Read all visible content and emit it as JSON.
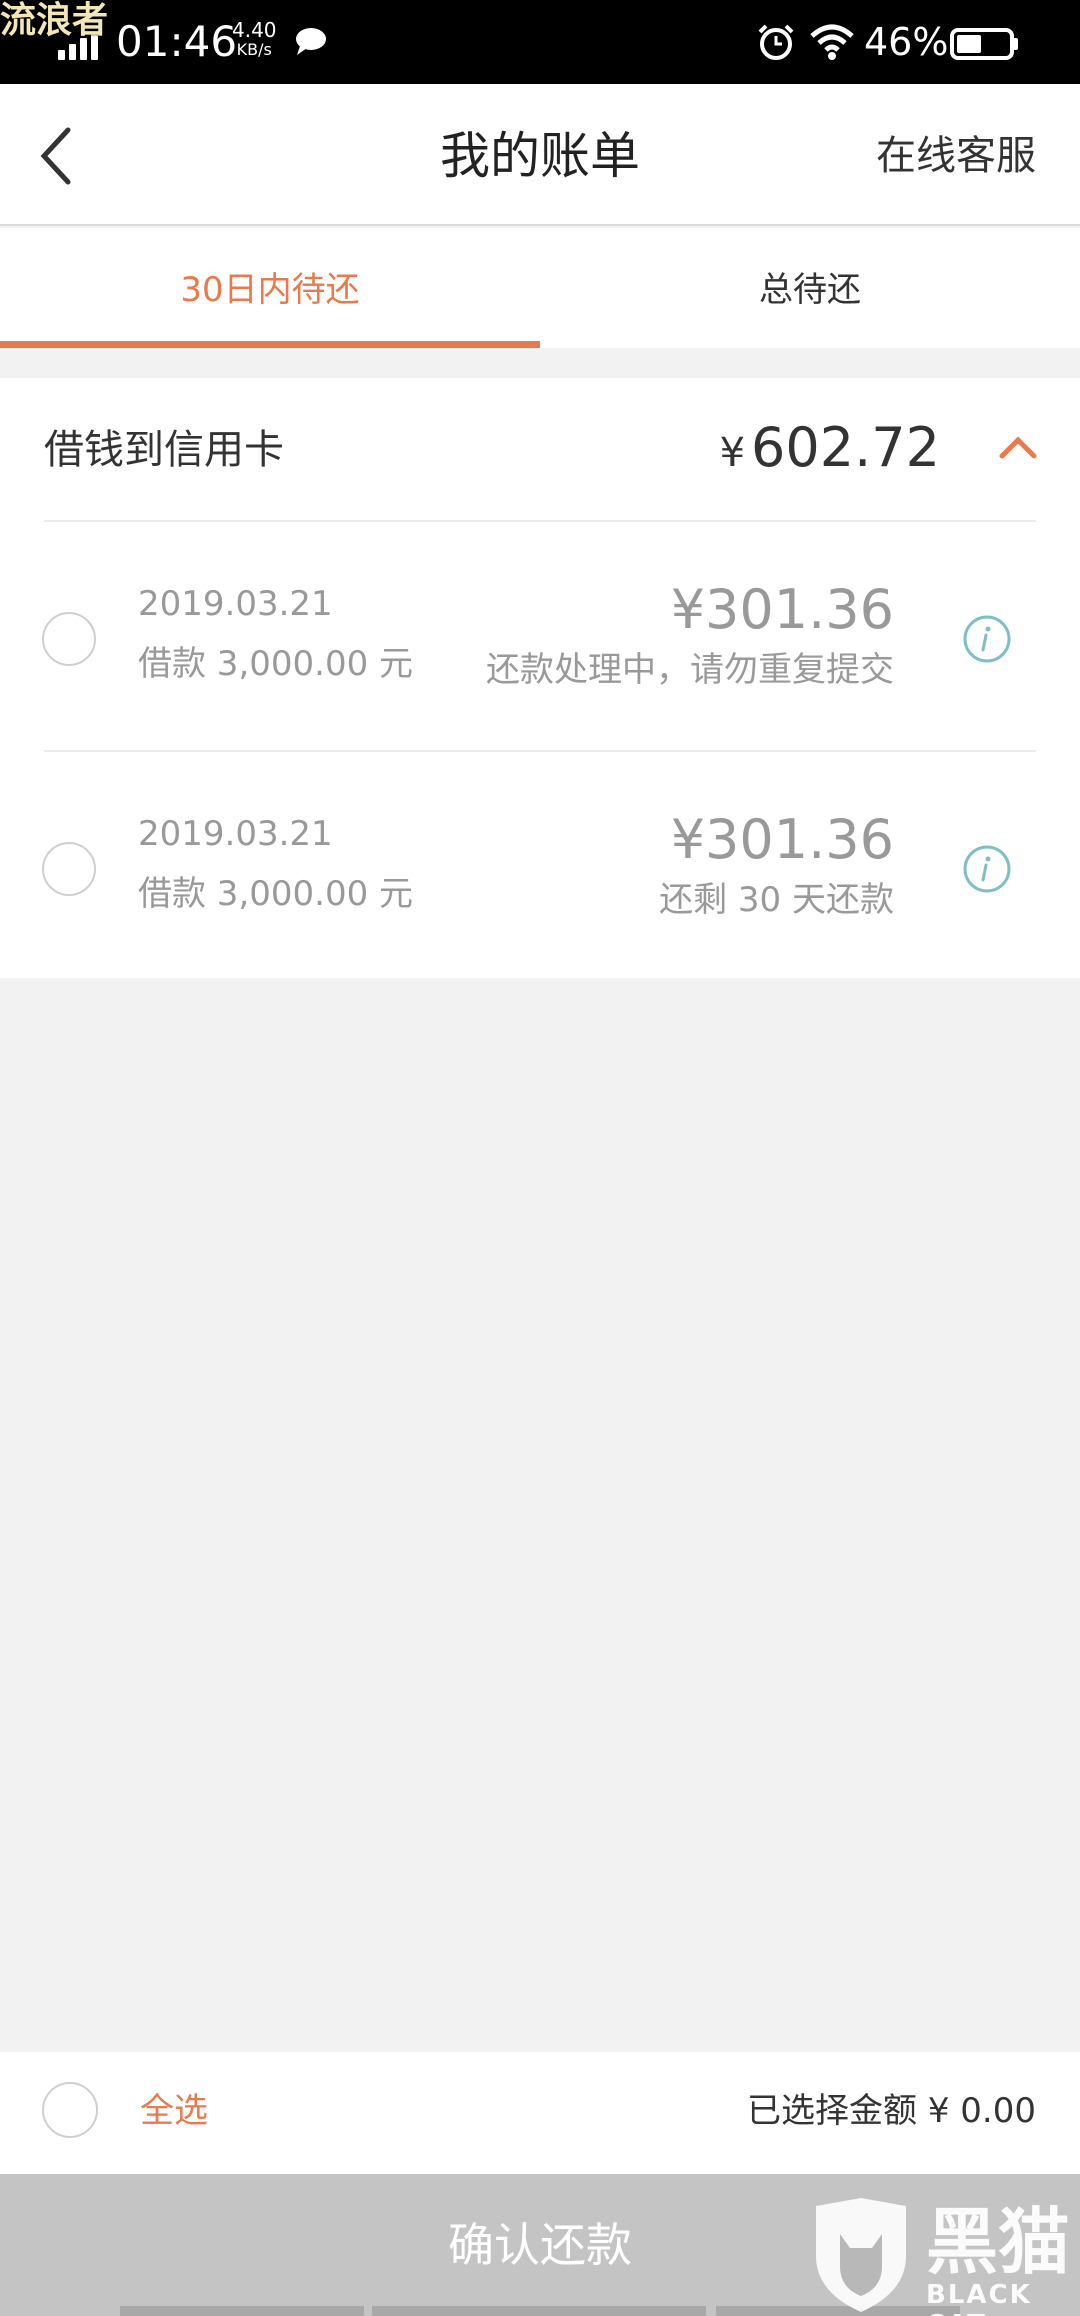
{
  "status_bar": {
    "watermark": "流浪者",
    "time": "01:46",
    "net_speed_value": "4.40",
    "net_speed_unit": "KB/s",
    "battery_percent": "46%"
  },
  "header": {
    "title": "我的账单",
    "service_label": "在线客服"
  },
  "tabs": [
    {
      "label": "30日内待还",
      "active": true
    },
    {
      "label": "总待还",
      "active": false
    }
  ],
  "group": {
    "title": "借钱到信用卡",
    "currency": "¥",
    "total": "602.72"
  },
  "bills": [
    {
      "date": "2019.03.21",
      "loan": "借款 3,000.00 元",
      "amount": "¥301.36",
      "status": "还款处理中，请勿重复提交"
    },
    {
      "date": "2019.03.21",
      "loan": "借款 3,000.00 元",
      "amount": "¥301.36",
      "status": "还剩 30 天还款"
    }
  ],
  "footer": {
    "select_all_label": "全选",
    "selected_amount": "已选择金额 ¥ 0.00",
    "confirm_label": "确认还款"
  },
  "watermark_logo": {
    "text": "黑猫",
    "sub": "BLACK CAT"
  },
  "colors": {
    "accent": "#e87a4d",
    "info": "#7fbfc2",
    "muted": "#999999"
  }
}
